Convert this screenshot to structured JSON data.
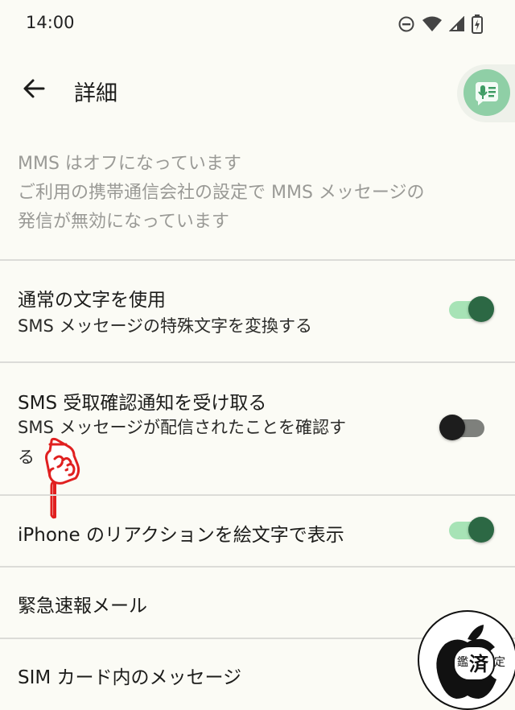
{
  "status_bar": {
    "time": "14:00"
  },
  "app_bar": {
    "title": "詳細"
  },
  "info": {
    "line1": "MMS はオフになっています",
    "line2": "ご利用の携帯通信会社の設定で MMS メッセージの",
    "line3": "発信が無効になっています"
  },
  "settings": [
    {
      "title": "通常の文字を使用",
      "subtitle": "SMS メッセージの特殊文字を変換する",
      "toggle": "on"
    },
    {
      "title": "SMS 受取確認通知を受け取る",
      "subtitle_line1": "SMS メッセージが配信されたことを確認す",
      "subtitle_line2": "る",
      "toggle": "off"
    },
    {
      "title": "iPhone のリアクションを絵文字で表示",
      "toggle": "on"
    },
    {
      "title": "緊急速報メール"
    },
    {
      "title": "SIM カード内のメッセージ"
    }
  ],
  "watermark": {
    "text1": "鑑",
    "text2": "済",
    "text3": "定"
  },
  "colors": {
    "background": "#fbfbf5",
    "toggle_on": "#2c6844",
    "toggle_on_track": "#a7e3b6",
    "toggle_off": "#1d1d1d",
    "hand": "#e02020"
  }
}
